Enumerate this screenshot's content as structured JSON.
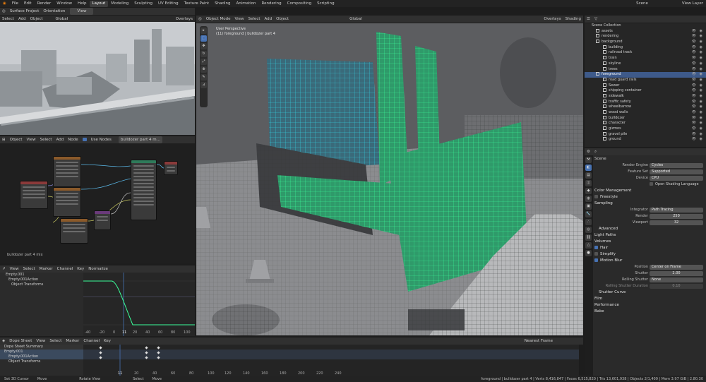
{
  "topbar": {
    "menus": [
      "File",
      "Edit",
      "Render",
      "Window",
      "Help"
    ],
    "workspaces": [
      "Layout",
      "Modeling",
      "Sculpting",
      "UV Editing",
      "Texture Paint",
      "Shading",
      "Animation",
      "Rendering",
      "Compositing",
      "Scripting"
    ],
    "active_workspace": "Layout",
    "scene_label": "Scene",
    "view_layer_label": "View Layer"
  },
  "left_viewport": {
    "header": [
      "Surface Project",
      "Orientation",
      "View"
    ],
    "menus": [
      "Select",
      "Add",
      "Object"
    ],
    "transform": "Global",
    "overlays": "Overlays"
  },
  "node_editor": {
    "header": [
      "Object",
      "View",
      "Select",
      "Add",
      "Node"
    ],
    "use_nodes": "Use Nodes",
    "material": "bulldozer part 4 m...",
    "footer_label": "bulldozer part 4 mix"
  },
  "graph_editor": {
    "menus": [
      "View",
      "Select",
      "Marker",
      "Channel",
      "Key"
    ],
    "normalize": "Normalize",
    "channels": [
      "Empty.001",
      "Empty.001Action",
      "Object Transforms"
    ],
    "ticks": [
      "-40",
      "-20",
      "0",
      "11",
      "20",
      "40",
      "60",
      "80",
      "100"
    ],
    "current_frame": "11"
  },
  "dope_sheet": {
    "mode": "Dope Sheet",
    "menus": [
      "View",
      "Select",
      "Marker",
      "Channel",
      "Key"
    ],
    "interp": "Nearest Frame",
    "channels": [
      "Dope Sheet Summary",
      "Empty.001",
      "Empty.001Action",
      "Object Transforms"
    ],
    "ticks": [
      "11",
      "20",
      "40",
      "60",
      "80",
      "100",
      "120",
      "140",
      "160",
      "180",
      "200",
      "220",
      "240"
    ]
  },
  "main_viewport": {
    "mode": "Object Mode",
    "menus": [
      "View",
      "Select",
      "Add",
      "Object"
    ],
    "transform": "Global",
    "overlays": "Overlays",
    "shading": "Shading",
    "info_line1": "User Perspective",
    "info_line2": "(11) foreground | bulldozer part 4"
  },
  "outliner": {
    "title": "Scene Collection",
    "items": [
      {
        "name": "assets",
        "indent": 1,
        "sel": false
      },
      {
        "name": "rendering",
        "indent": 1,
        "sel": false
      },
      {
        "name": "background",
        "indent": 1,
        "sel": false
      },
      {
        "name": "building",
        "indent": 2,
        "sel": false
      },
      {
        "name": "railroad track",
        "indent": 2,
        "sel": false
      },
      {
        "name": "train",
        "indent": 2,
        "sel": false
      },
      {
        "name": "skyline",
        "indent": 2,
        "sel": false
      },
      {
        "name": "trees",
        "indent": 2,
        "sel": false
      },
      {
        "name": "foreground",
        "indent": 1,
        "sel": true
      },
      {
        "name": "road guard rails",
        "indent": 2,
        "sel": false
      },
      {
        "name": "Sewer",
        "indent": 2,
        "sel": false
      },
      {
        "name": "shipping container",
        "indent": 2,
        "sel": false
      },
      {
        "name": "sidewalk",
        "indent": 2,
        "sel": false
      },
      {
        "name": "traffic safety",
        "indent": 2,
        "sel": false
      },
      {
        "name": "wheelbarrow",
        "indent": 2,
        "sel": false
      },
      {
        "name": "wood walls",
        "indent": 2,
        "sel": false
      },
      {
        "name": "bulldozer",
        "indent": 2,
        "sel": false
      },
      {
        "name": "character",
        "indent": 2,
        "sel": false
      },
      {
        "name": "gizmos",
        "indent": 2,
        "sel": false
      },
      {
        "name": "gravel pile",
        "indent": 2,
        "sel": false
      },
      {
        "name": "ground",
        "indent": 2,
        "sel": false
      }
    ]
  },
  "properties": {
    "scene_name": "Scene",
    "render_engine_label": "Render Engine",
    "render_engine": "Cycles",
    "feature_set_label": "Feature Set",
    "feature_set": "Supported",
    "device_label": "Device",
    "device": "CPU",
    "osl": "Open Shading Language",
    "color_management": "Color Management",
    "freestyle": "Freestyle",
    "sampling": "Sampling",
    "integrator_label": "Integrator",
    "integrator": "Path Tracing",
    "render_label": "Render",
    "render_samples": "250",
    "viewport_label": "Viewport",
    "viewport_samples": "32",
    "advanced": "Advanced",
    "light_paths": "Light Paths",
    "volumes": "Volumes",
    "hair": "Hair",
    "simplify": "Simplify",
    "motion_blur": "Motion Blur",
    "position_label": "Position",
    "position": "Center on Frame",
    "shutter_label": "Shutter",
    "shutter": "2.00",
    "rolling_shutter_label": "Rolling Shutter",
    "rolling_shutter": "None",
    "rolling_duration_label": "Rolling Shutter Duration",
    "rolling_duration": "0.10",
    "shutter_curve": "Shutter Curve",
    "film": "Film",
    "performance": "Performance",
    "bake": "Bake"
  },
  "status": {
    "left": [
      "Set 3D Cursor",
      "Move",
      "Rotate View",
      "Select",
      "Move"
    ],
    "right": "foreground | bulldozer part 4 | Verts 8,416,847 | Faces 6,515,820 | Tris 13,601,938 | Objects 2/1,409 | Mem 3.97 GiB | 2.80.30"
  },
  "colors": {
    "accent": "#4772b3",
    "selection": "#3bff9a",
    "selection2": "#34d9e8"
  }
}
